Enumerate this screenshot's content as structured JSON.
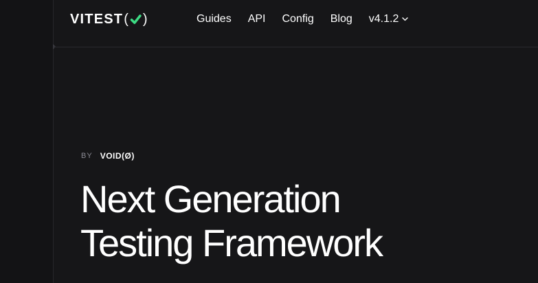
{
  "logo": {
    "text": "VITEST",
    "paren_open": "(",
    "paren_close": ")",
    "check_icon": "check-icon",
    "check_color": "#3ddc84"
  },
  "nav": {
    "items": [
      {
        "label": "Guides"
      },
      {
        "label": "API"
      },
      {
        "label": "Config"
      },
      {
        "label": "Blog"
      }
    ],
    "version": {
      "label": "v4.1.2",
      "icon": "chevron-down-icon"
    }
  },
  "hero": {
    "by_label": "BY",
    "brand": "VOID(Ø)",
    "title_line1": "Next Generation",
    "title_line2": "Testing Framework"
  },
  "colors": {
    "background": "#161618",
    "rail": "#131315",
    "text": "#ffffff",
    "muted": "#8b8b94",
    "accent": "#3ddc84"
  }
}
